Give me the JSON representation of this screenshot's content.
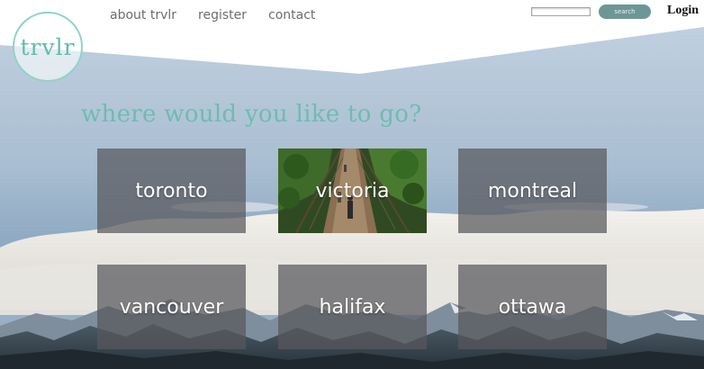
{
  "brand": {
    "logo_text": "trvlr"
  },
  "nav": {
    "items": [
      "about trvlr",
      "register",
      "contact"
    ]
  },
  "search": {
    "placeholder": "",
    "button_label": "search"
  },
  "auth": {
    "login_label": "Login"
  },
  "headline": "where would you like to go?",
  "cities": [
    "toronto",
    "victoria",
    "montreal",
    "vancouver",
    "halifax",
    "ottawa"
  ],
  "colors": {
    "accent": "#6fbbb2",
    "logo_ring": "#8fd3c6",
    "search_button": "#6d9795",
    "tile_overlay": "#58585c"
  },
  "icons": {
    "victoria_tile": "suspension-bridge-photo"
  }
}
